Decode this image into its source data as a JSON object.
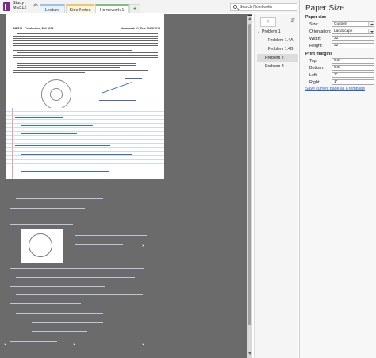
{
  "notebook": {
    "name_line1": "Study",
    "name_line2": "ME512",
    "icon": "notebook-icon"
  },
  "toolbar": {
    "back_icon": "back-arrow-icon"
  },
  "sections": [
    {
      "label": "Lecture",
      "color": "#9cc3e6"
    },
    {
      "label": "Side Notes",
      "color": "#e9c96a"
    },
    {
      "label": "Homework 1",
      "color": "#7fbf7f"
    }
  ],
  "add_section_label": "+",
  "search": {
    "placeholder": "Search Notebooks",
    "icon": "search-icon"
  },
  "document": {
    "header_left": "ME512 - Conduction, Fall 2015",
    "header_right": "Homework #1, Due 10/06/2015"
  },
  "pages_panel": {
    "add_page_label": "+",
    "sort_icon": "sort-icon",
    "items": [
      {
        "label": "Problem 1",
        "level": "parent"
      },
      {
        "label": "Problem 1.4A",
        "level": "child"
      },
      {
        "label": "Problem 1.4B",
        "level": "child"
      },
      {
        "label": "Problem 2",
        "level": "parent",
        "selected": true
      },
      {
        "label": "Problem 3",
        "level": "parent"
      }
    ]
  },
  "paper_size": {
    "title": "Paper Size",
    "section_size": "Paper size",
    "size_label": "Size:",
    "size_value": "Custom",
    "orientation_label": "Orientation:",
    "orientation_value": "Landscape",
    "width_label": "Width:",
    "width_value": "22\"",
    "height_label": "Height:",
    "height_value": "22\"",
    "section_margins": "Print margins",
    "top_label": "Top:",
    "top_value": "0.5\"",
    "bottom_label": "Bottom:",
    "bottom_value": "0.5\"",
    "left_label": "Left:",
    "left_value": "1\"",
    "right_label": "Right:",
    "right_value": "1\"",
    "template_link": "Save current page as a template"
  }
}
